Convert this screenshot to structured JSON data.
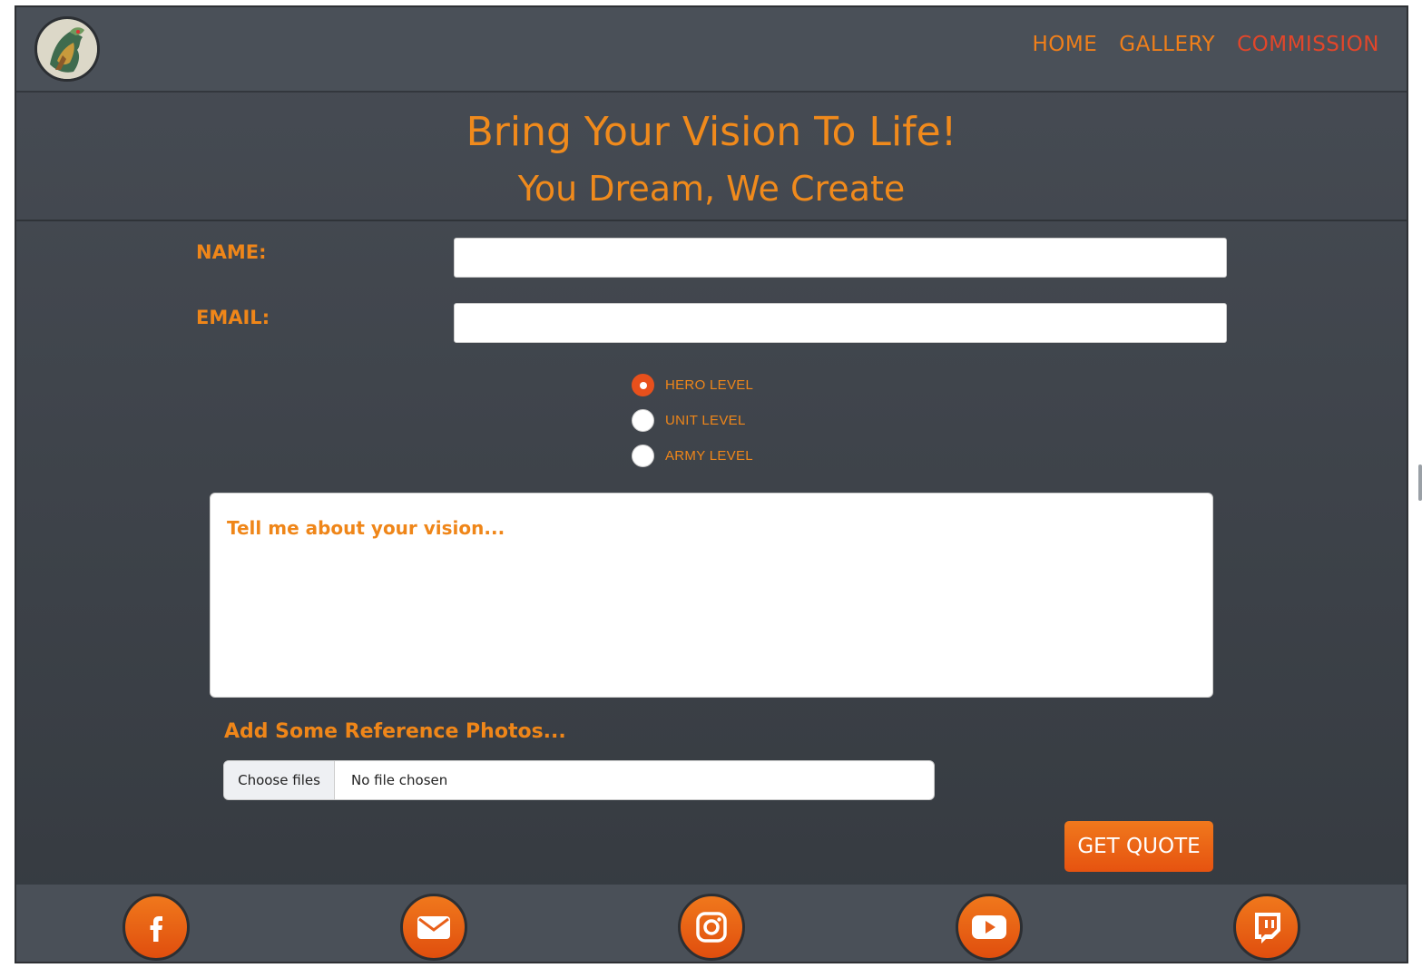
{
  "nav": {
    "links": [
      "HOME",
      "GALLERY",
      "COMMISSION"
    ],
    "active": "COMMISSION"
  },
  "hero": {
    "title": "Bring Your Vision To Life!",
    "subtitle": "You Dream, We Create"
  },
  "form": {
    "name_label": "NAME:",
    "email_label": "EMAIL:",
    "name_value": "",
    "email_value": "",
    "levels": [
      {
        "label": "HERO LEVEL",
        "checked": true
      },
      {
        "label": "UNIT LEVEL",
        "checked": false
      },
      {
        "label": "ARMY LEVEL",
        "checked": false
      }
    ],
    "vision_placeholder": "Tell me about your vision...",
    "reference_label": "Add Some Reference Photos...",
    "file_button": "Choose files",
    "file_status": "No file chosen",
    "submit_label": "GET QUOTE"
  },
  "footer": {
    "socials": [
      "facebook-icon",
      "mail-icon",
      "instagram-icon",
      "youtube-icon",
      "twitch-icon"
    ]
  },
  "colors": {
    "accent": "#f08a1c",
    "active_nav": "#e2462a",
    "button": "#e8601a",
    "background": "#41464d"
  }
}
